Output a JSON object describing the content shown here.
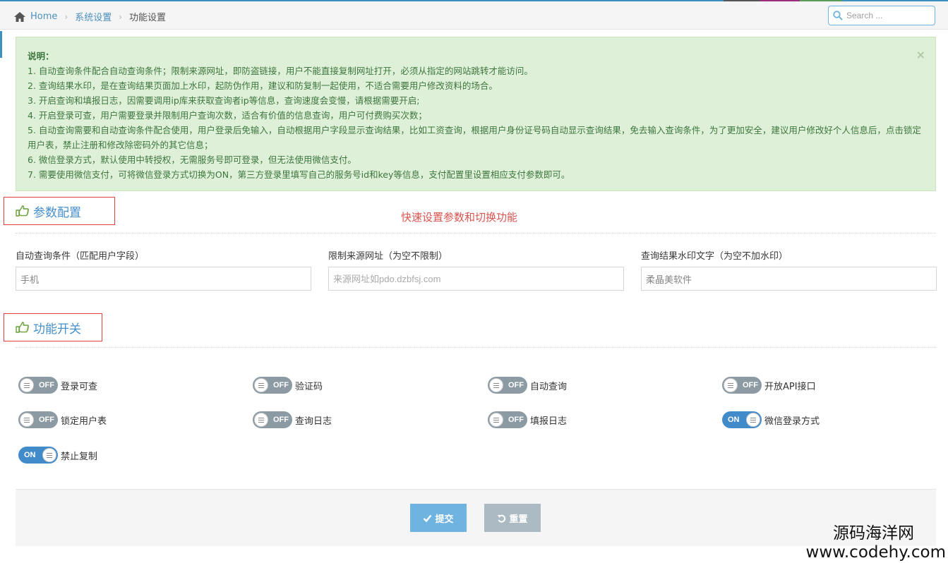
{
  "breadcrumb": {
    "home": "Home",
    "level1": "系统设置",
    "current": "功能设置"
  },
  "search": {
    "placeholder": "Search ..."
  },
  "alert": {
    "title": "说明：",
    "close": "×",
    "lines": [
      "1. 自动查询条件配合自动查询条件；限制来源网址，即防盗链接，用户不能直接复制网址打开，必须从指定的网站跳转才能访问。",
      "2. 查询结果水印，是在查询结果页面加上水印，起防伪作用，建议和防复制一起使用，不适合需要用户修改资料的场合。",
      "3. 开启查询和填报日志，因需要调用ip库来获取查询者ip等信息，查询速度会变慢，请根据需要开启;",
      "4. 开启登录可查，用户需要登录并限制用户查询次数，适合有价值的信息查询，用户可付费购买次数；",
      "5. 自动查询需要和自动查询条件配合使用，用户登录后免输入，自动根据用户字段显示查询结果，比如工资查询，根据用户身份证号码自动显示查询结果，免去输入查询条件，为了更加安全，建议用户修改好个人信息后，点击锁定用户表，禁止注册和修改除密码外的其它信息；",
      "6. 微信登录方式，默认使用中转授权，无需服务号即可登录，但无法使用微信支付。",
      "7. 需要使用微信支付，可将微信登录方式切换为ON，第三方登录里填写自己的服务号id和key等信息，支付配置里设置相应支付参数即可。"
    ]
  },
  "params_section": {
    "title": "参数配置",
    "annotation": "快速设置参数和切换功能",
    "fields": [
      {
        "label": "自动查询条件（匹配用户字段）",
        "value": "手机",
        "placeholder": ""
      },
      {
        "label": "限制来源网址（为空不限制）",
        "value": "",
        "placeholder": "来源网址如pdo.dzbfsj.com"
      },
      {
        "label": "查询结果水印文字（为空不加水印）",
        "value": "柔晶美软件",
        "placeholder": ""
      }
    ]
  },
  "switch_section": {
    "title": "功能开关",
    "switches": [
      {
        "label": "登录可查",
        "state": "OFF"
      },
      {
        "label": "验证码",
        "state": "OFF"
      },
      {
        "label": "自动查询",
        "state": "OFF"
      },
      {
        "label": "开放API接口",
        "state": "OFF"
      },
      {
        "label": "锁定用户表",
        "state": "OFF"
      },
      {
        "label": "查询日志",
        "state": "OFF"
      },
      {
        "label": "填报日志",
        "state": "OFF"
      },
      {
        "label": "微信登录方式",
        "state": "ON"
      },
      {
        "label": "禁止复制",
        "state": "ON"
      }
    ]
  },
  "actions": {
    "submit": "提交",
    "reset": "重置"
  },
  "watermark": {
    "name": "源码海洋网",
    "url": "www.codehy.com"
  },
  "colors": {
    "accent": "#478fca",
    "alert_bg": "#dff0d8",
    "alert_text": "#3c763d",
    "toggle_on": "#428bca",
    "toggle_off": "#8b9aa3",
    "annotation": "#d9534f"
  }
}
